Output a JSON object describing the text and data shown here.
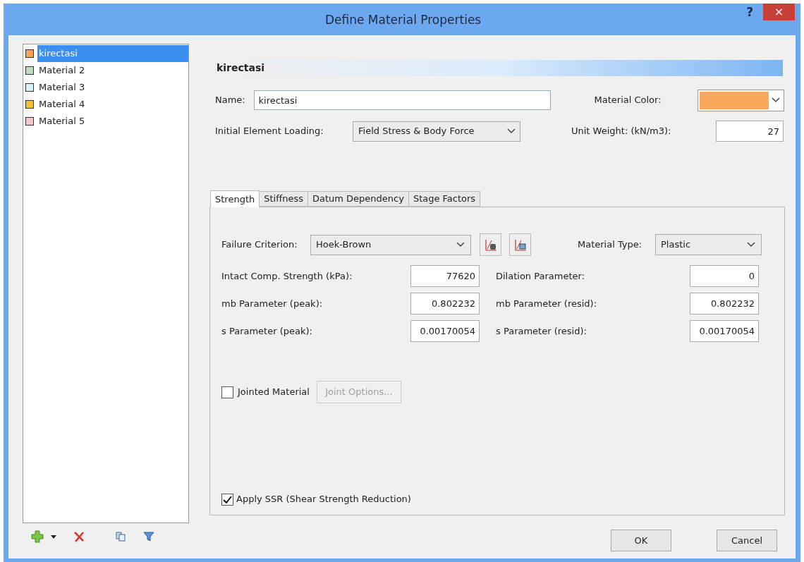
{
  "window": {
    "title": "Define Material Properties",
    "help": "?",
    "close": "×"
  },
  "materials": [
    {
      "name": "kirectasi",
      "color": "#f7a35c",
      "selected": true
    },
    {
      "name": "Material 2",
      "color": "#c0dcc0",
      "selected": false
    },
    {
      "name": "Material 3",
      "color": "#d8f4f8",
      "selected": false
    },
    {
      "name": "Material 4",
      "color": "#f5c030",
      "selected": false
    },
    {
      "name": "Material 5",
      "color": "#f4c8c8",
      "selected": false
    }
  ],
  "header": "kirectasi",
  "name_field": {
    "label": "Name:",
    "value": "kirectasi"
  },
  "material_color": {
    "label": "Material Color:",
    "color": "#f9a85c"
  },
  "initial_loading": {
    "label": "Initial Element Loading:",
    "value": "Field Stress & Body Force"
  },
  "unit_weight": {
    "label": "Unit Weight: (kN/m3):",
    "value": "27"
  },
  "tabs": [
    {
      "label": "Strength",
      "selected": true
    },
    {
      "label": "Stiffness",
      "selected": false
    },
    {
      "label": "Datum Dependency",
      "selected": false
    },
    {
      "label": "Stage Factors",
      "selected": false
    }
  ],
  "failure_criterion": {
    "label": "Failure Criterion:",
    "value": "Hoek-Brown"
  },
  "material_type": {
    "label": "Material Type:",
    "value": "Plastic"
  },
  "parameter_rows": [
    {
      "left_label": "Intact Comp. Strength (kPa):",
      "left_value": "77620",
      "right_label": "Dilation Parameter:",
      "right_value": "0"
    },
    {
      "left_label": "mb Parameter (peak):",
      "left_value": "0.802232",
      "right_label": "mb Parameter (resid):",
      "right_value": "0.802232"
    },
    {
      "left_label": "s Parameter (peak):",
      "left_value": "0.00170054",
      "right_label": "s Parameter (resid):",
      "right_value": "0.00170054"
    }
  ],
  "jointed": {
    "label": "Jointed Material",
    "checked": false
  },
  "joint_options": {
    "label": "Joint Options...",
    "disabled": true
  },
  "apply_ssr": {
    "label": "Apply SSR (Shear Strength Reduction)",
    "checked": true
  },
  "buttons": [
    "OK",
    "Cancel"
  ]
}
